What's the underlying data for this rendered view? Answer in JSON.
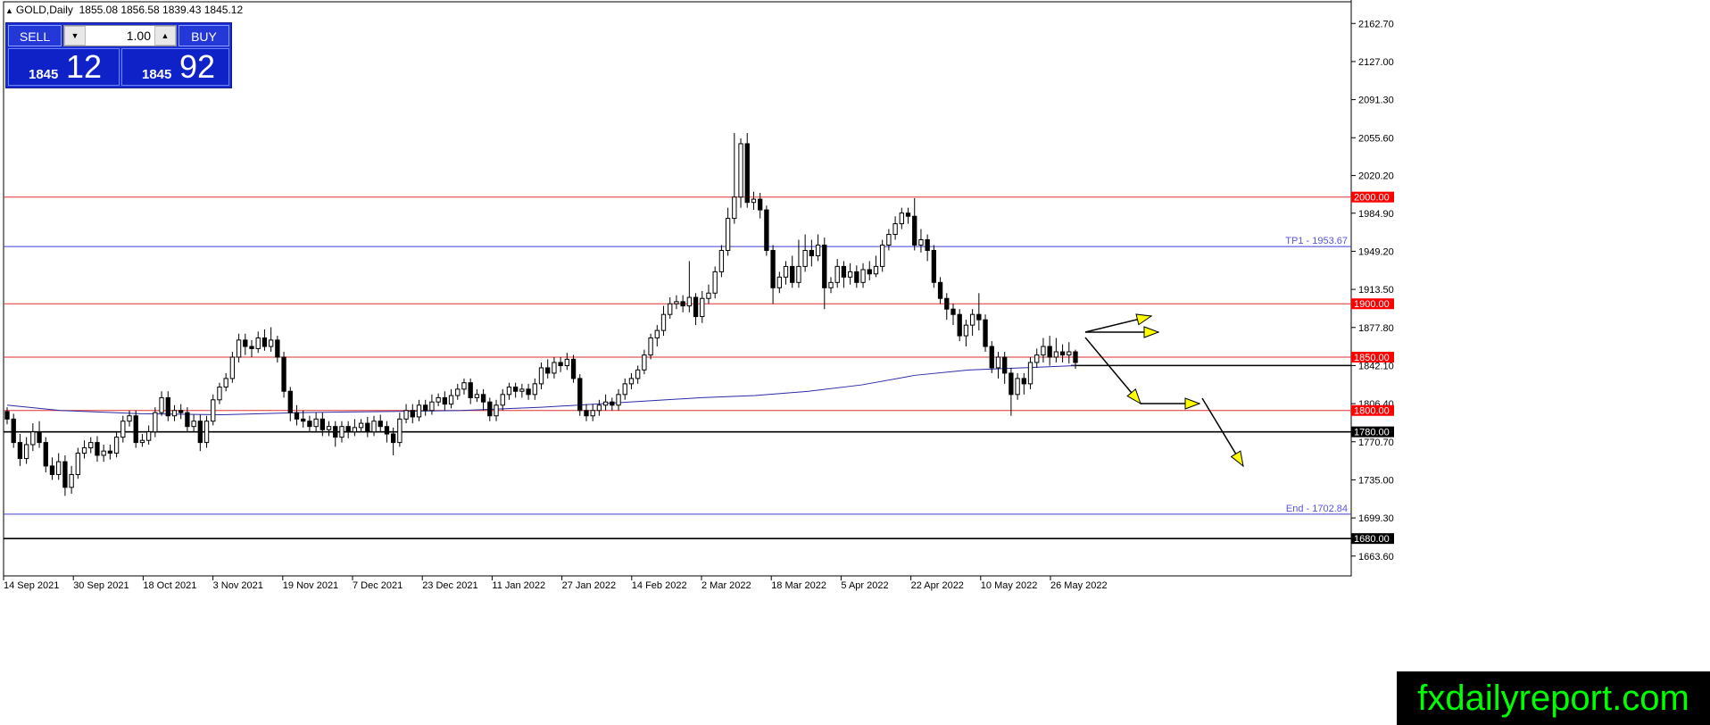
{
  "header": {
    "symbol": "GOLD,Daily",
    "ohlc": "1855.08 1856.58 1839.43 1845.12"
  },
  "trade_panel": {
    "sell_label": "SELL",
    "buy_label": "BUY",
    "lot": "1.00",
    "sell_price_small": "1845",
    "sell_price_big": "12",
    "buy_price_small": "1845",
    "buy_price_big": "92"
  },
  "watermark": "fxdailyreport.com",
  "colors": {
    "resistance_red": "#e03030",
    "target_blue": "#3f3fd8",
    "support_black": "#000000",
    "arrow_yellow": "#ffff00",
    "ma_line": "#2a2aa8",
    "price_label_red_bg": "#ff0000"
  },
  "chart_data": {
    "type": "candlestick",
    "symbol": "GOLD",
    "timeframe": "Daily",
    "ylim": [
      1645,
      2183
    ],
    "y_ticks": [
      "2162.70",
      "2127.00",
      "2091.30",
      "2055.60",
      "2020.20",
      "1984.90",
      "1949.20",
      "1913.50",
      "1877.80",
      "1842.10",
      "1806.40",
      "1770.70",
      "1735.00",
      "1699.30",
      "1663.60"
    ],
    "x_ticks": [
      "14 Sep 2021",
      "30 Sep 2021",
      "18 Oct 2021",
      "3 Nov 2021",
      "19 Nov 2021",
      "7 Dec 2021",
      "23 Dec 2021",
      "11 Jan 2022",
      "27 Jan 2022",
      "14 Feb 2022",
      "2 Mar 2022",
      "18 Mar 2022",
      "5 Apr 2022",
      "22 Apr 2022",
      "10 May 2022",
      "26 May 2022"
    ],
    "horizontal_levels": [
      {
        "value": 2000.0,
        "label": "2000.00",
        "color": "red",
        "style": "box"
      },
      {
        "value": 1953.67,
        "label": "TP1 - 1953.67",
        "color": "blue",
        "style": "text"
      },
      {
        "value": 1900.0,
        "label": "1900.00",
        "color": "red",
        "style": "box"
      },
      {
        "value": 1850.0,
        "label": "1850.00",
        "color": "red",
        "style": "box"
      },
      {
        "value": 1800.0,
        "label": "1800.00",
        "color": "red",
        "style": "box"
      },
      {
        "value": 1780.0,
        "label": "1780.00",
        "color": "black",
        "style": "box"
      },
      {
        "value": 1702.84,
        "label": "End - 1702.84",
        "color": "blue",
        "style": "text"
      },
      {
        "value": 1680.0,
        "label": "1680.00",
        "color": "black",
        "style": "box"
      }
    ],
    "current_price_line": 1842.1,
    "moving_average": [
      {
        "x": 0,
        "y": 1805
      },
      {
        "x": 60,
        "y": 1800
      },
      {
        "x": 150,
        "y": 1797
      },
      {
        "x": 240,
        "y": 1796
      },
      {
        "x": 330,
        "y": 1798
      },
      {
        "x": 420,
        "y": 1799
      },
      {
        "x": 510,
        "y": 1800
      },
      {
        "x": 600,
        "y": 1803
      },
      {
        "x": 660,
        "y": 1806
      },
      {
        "x": 720,
        "y": 1809
      },
      {
        "x": 780,
        "y": 1812
      },
      {
        "x": 840,
        "y": 1814
      },
      {
        "x": 900,
        "y": 1818
      },
      {
        "x": 960,
        "y": 1824
      },
      {
        "x": 1020,
        "y": 1833
      },
      {
        "x": 1080,
        "y": 1838
      },
      {
        "x": 1140,
        "y": 1840
      },
      {
        "x": 1200,
        "y": 1842
      }
    ],
    "candles": [
      [
        1799,
        1792,
        1803,
        1787
      ],
      [
        1792,
        1770,
        1797,
        1765
      ],
      [
        1770,
        1755,
        1778,
        1748
      ],
      [
        1755,
        1768,
        1775,
        1750
      ],
      [
        1768,
        1780,
        1788,
        1762
      ],
      [
        1780,
        1770,
        1790,
        1765
      ],
      [
        1770,
        1748,
        1775,
        1742
      ],
      [
        1748,
        1740,
        1756,
        1735
      ],
      [
        1740,
        1752,
        1760,
        1735
      ],
      [
        1752,
        1728,
        1758,
        1720
      ],
      [
        1728,
        1740,
        1748,
        1722
      ],
      [
        1740,
        1760,
        1765,
        1736
      ],
      [
        1760,
        1765,
        1772,
        1755
      ],
      [
        1765,
        1770,
        1775,
        1760
      ],
      [
        1770,
        1758,
        1776,
        1752
      ],
      [
        1758,
        1762,
        1768,
        1752
      ],
      [
        1762,
        1760,
        1768,
        1754
      ],
      [
        1760,
        1775,
        1780,
        1756
      ],
      [
        1775,
        1790,
        1795,
        1770
      ],
      [
        1790,
        1795,
        1800,
        1785
      ],
      [
        1795,
        1770,
        1800,
        1765
      ],
      [
        1770,
        1772,
        1778,
        1766
      ],
      [
        1772,
        1780,
        1786,
        1768
      ],
      [
        1780,
        1798,
        1803,
        1775
      ],
      [
        1798,
        1812,
        1818,
        1795
      ],
      [
        1812,
        1795,
        1818,
        1790
      ],
      [
        1795,
        1800,
        1805,
        1790
      ],
      [
        1800,
        1798,
        1806,
        1792
      ],
      [
        1798,
        1785,
        1803,
        1780
      ],
      [
        1785,
        1790,
        1796,
        1780
      ],
      [
        1790,
        1770,
        1796,
        1762
      ],
      [
        1770,
        1790,
        1795,
        1765
      ],
      [
        1790,
        1810,
        1815,
        1786
      ],
      [
        1810,
        1822,
        1826,
        1806
      ],
      [
        1822,
        1830,
        1835,
        1818
      ],
      [
        1830,
        1850,
        1855,
        1826
      ],
      [
        1850,
        1866,
        1872,
        1845
      ],
      [
        1866,
        1860,
        1872,
        1852
      ],
      [
        1860,
        1858,
        1866,
        1850
      ],
      [
        1858,
        1868,
        1874,
        1854
      ],
      [
        1868,
        1860,
        1876,
        1856
      ],
      [
        1860,
        1866,
        1878,
        1855
      ],
      [
        1866,
        1850,
        1870,
        1845
      ],
      [
        1850,
        1818,
        1855,
        1812
      ],
      [
        1818,
        1798,
        1822,
        1790
      ],
      [
        1798,
        1792,
        1805,
        1786
      ],
      [
        1792,
        1790,
        1800,
        1784
      ],
      [
        1790,
        1785,
        1795,
        1780
      ],
      [
        1785,
        1792,
        1798,
        1780
      ],
      [
        1792,
        1782,
        1798,
        1776
      ],
      [
        1782,
        1785,
        1790,
        1776
      ],
      [
        1785,
        1775,
        1790,
        1766
      ],
      [
        1775,
        1785,
        1790,
        1770
      ],
      [
        1785,
        1780,
        1790,
        1774
      ],
      [
        1780,
        1784,
        1792,
        1776
      ],
      [
        1784,
        1788,
        1792,
        1780
      ],
      [
        1788,
        1780,
        1794,
        1775
      ],
      [
        1780,
        1790,
        1795,
        1776
      ],
      [
        1790,
        1785,
        1796,
        1780
      ],
      [
        1785,
        1778,
        1790,
        1770
      ],
      [
        1778,
        1770,
        1784,
        1758
      ],
      [
        1770,
        1792,
        1798,
        1766
      ],
      [
        1792,
        1800,
        1806,
        1788
      ],
      [
        1800,
        1794,
        1806,
        1788
      ],
      [
        1794,
        1805,
        1810,
        1790
      ],
      [
        1805,
        1800,
        1810,
        1795
      ],
      [
        1800,
        1808,
        1815,
        1796
      ],
      [
        1808,
        1812,
        1816,
        1804
      ],
      [
        1812,
        1806,
        1818,
        1800
      ],
      [
        1806,
        1814,
        1820,
        1802
      ],
      [
        1814,
        1820,
        1825,
        1810
      ],
      [
        1820,
        1826,
        1830,
        1815
      ],
      [
        1826,
        1812,
        1830,
        1806
      ],
      [
        1812,
        1815,
        1820,
        1808
      ],
      [
        1815,
        1808,
        1820,
        1800
      ],
      [
        1808,
        1795,
        1812,
        1790
      ],
      [
        1795,
        1805,
        1810,
        1790
      ],
      [
        1805,
        1815,
        1820,
        1800
      ],
      [
        1815,
        1822,
        1826,
        1810
      ],
      [
        1822,
        1818,
        1826,
        1812
      ],
      [
        1818,
        1820,
        1825,
        1812
      ],
      [
        1820,
        1815,
        1825,
        1810
      ],
      [
        1815,
        1825,
        1830,
        1810
      ],
      [
        1825,
        1840,
        1845,
        1820
      ],
      [
        1840,
        1835,
        1848,
        1830
      ],
      [
        1835,
        1845,
        1850,
        1830
      ],
      [
        1845,
        1842,
        1850,
        1836
      ],
      [
        1842,
        1848,
        1854,
        1838
      ],
      [
        1848,
        1830,
        1852,
        1826
      ],
      [
        1830,
        1800,
        1834,
        1795
      ],
      [
        1800,
        1795,
        1806,
        1790
      ],
      [
        1795,
        1800,
        1806,
        1790
      ],
      [
        1800,
        1805,
        1810,
        1795
      ],
      [
        1805,
        1808,
        1815,
        1800
      ],
      [
        1808,
        1805,
        1812,
        1800
      ],
      [
        1805,
        1815,
        1820,
        1800
      ],
      [
        1815,
        1825,
        1830,
        1810
      ],
      [
        1825,
        1830,
        1835,
        1820
      ],
      [
        1830,
        1838,
        1842,
        1825
      ],
      [
        1838,
        1852,
        1857,
        1834
      ],
      [
        1852,
        1868,
        1872,
        1848
      ],
      [
        1868,
        1875,
        1880,
        1860
      ],
      [
        1875,
        1890,
        1898,
        1870
      ],
      [
        1890,
        1900,
        1906,
        1886
      ],
      [
        1900,
        1902,
        1908,
        1895
      ],
      [
        1902,
        1898,
        1908,
        1892
      ],
      [
        1898,
        1906,
        1940,
        1892
      ],
      [
        1906,
        1888,
        1910,
        1880
      ],
      [
        1888,
        1905,
        1912,
        1882
      ],
      [
        1905,
        1910,
        1918,
        1900
      ],
      [
        1910,
        1930,
        1935,
        1905
      ],
      [
        1930,
        1950,
        1955,
        1925
      ],
      [
        1950,
        1980,
        1990,
        1945
      ],
      [
        1980,
        2000,
        2060,
        1975
      ],
      [
        2000,
        2050,
        2055,
        1990
      ],
      [
        2050,
        1995,
        2060,
        1990
      ],
      [
        1995,
        1998,
        2005,
        1988
      ],
      [
        1998,
        1988,
        2004,
        1980
      ],
      [
        1988,
        1950,
        1992,
        1945
      ],
      [
        1950,
        1915,
        1955,
        1900
      ],
      [
        1915,
        1925,
        1930,
        1910
      ],
      [
        1925,
        1935,
        1940,
        1918
      ],
      [
        1935,
        1920,
        1945,
        1915
      ],
      [
        1920,
        1935,
        1960,
        1915
      ],
      [
        1935,
        1950,
        1965,
        1930
      ],
      [
        1950,
        1945,
        1960,
        1935
      ],
      [
        1945,
        1955,
        1965,
        1940
      ],
      [
        1955,
        1915,
        1962,
        1895
      ],
      [
        1915,
        1920,
        1925,
        1910
      ],
      [
        1920,
        1935,
        1942,
        1915
      ],
      [
        1935,
        1925,
        1940,
        1915
      ],
      [
        1925,
        1930,
        1938,
        1918
      ],
      [
        1930,
        1920,
        1936,
        1915
      ],
      [
        1920,
        1932,
        1938,
        1915
      ],
      [
        1932,
        1928,
        1940,
        1922
      ],
      [
        1928,
        1935,
        1945,
        1925
      ],
      [
        1935,
        1955,
        1960,
        1930
      ],
      [
        1955,
        1965,
        1970,
        1950
      ],
      [
        1965,
        1975,
        1982,
        1960
      ],
      [
        1975,
        1985,
        1990,
        1970
      ],
      [
        1985,
        1982,
        1990,
        1975
      ],
      [
        1982,
        1955,
        1999,
        1950
      ],
      [
        1955,
        1960,
        1970,
        1948
      ],
      [
        1960,
        1950,
        1965,
        1940
      ],
      [
        1950,
        1920,
        1955,
        1915
      ],
      [
        1920,
        1905,
        1925,
        1900
      ],
      [
        1905,
        1895,
        1910,
        1885
      ],
      [
        1895,
        1890,
        1900,
        1880
      ],
      [
        1890,
        1870,
        1895,
        1865
      ],
      [
        1870,
        1880,
        1885,
        1860
      ],
      [
        1880,
        1890,
        1895,
        1870
      ],
      [
        1890,
        1885,
        1910,
        1875
      ],
      [
        1885,
        1860,
        1890,
        1855
      ],
      [
        1860,
        1840,
        1865,
        1835
      ],
      [
        1840,
        1850,
        1855,
        1830
      ],
      [
        1850,
        1835,
        1855,
        1825
      ],
      [
        1835,
        1815,
        1840,
        1795
      ],
      [
        1815,
        1830,
        1835,
        1810
      ],
      [
        1830,
        1825,
        1835,
        1815
      ],
      [
        1825,
        1845,
        1850,
        1820
      ],
      [
        1845,
        1852,
        1858,
        1840
      ],
      [
        1852,
        1860,
        1868,
        1845
      ],
      [
        1860,
        1850,
        1870,
        1842
      ],
      [
        1850,
        1855,
        1868,
        1845
      ],
      [
        1855,
        1852,
        1862,
        1845
      ],
      [
        1852,
        1855,
        1864,
        1844
      ],
      [
        1855,
        1845,
        1857,
        1839
      ]
    ],
    "drawn_arrows": "yellow-headed trend arrows projecting from last candle: one up-right, one right, one down to 1780 then down toward End - 1702.84"
  }
}
